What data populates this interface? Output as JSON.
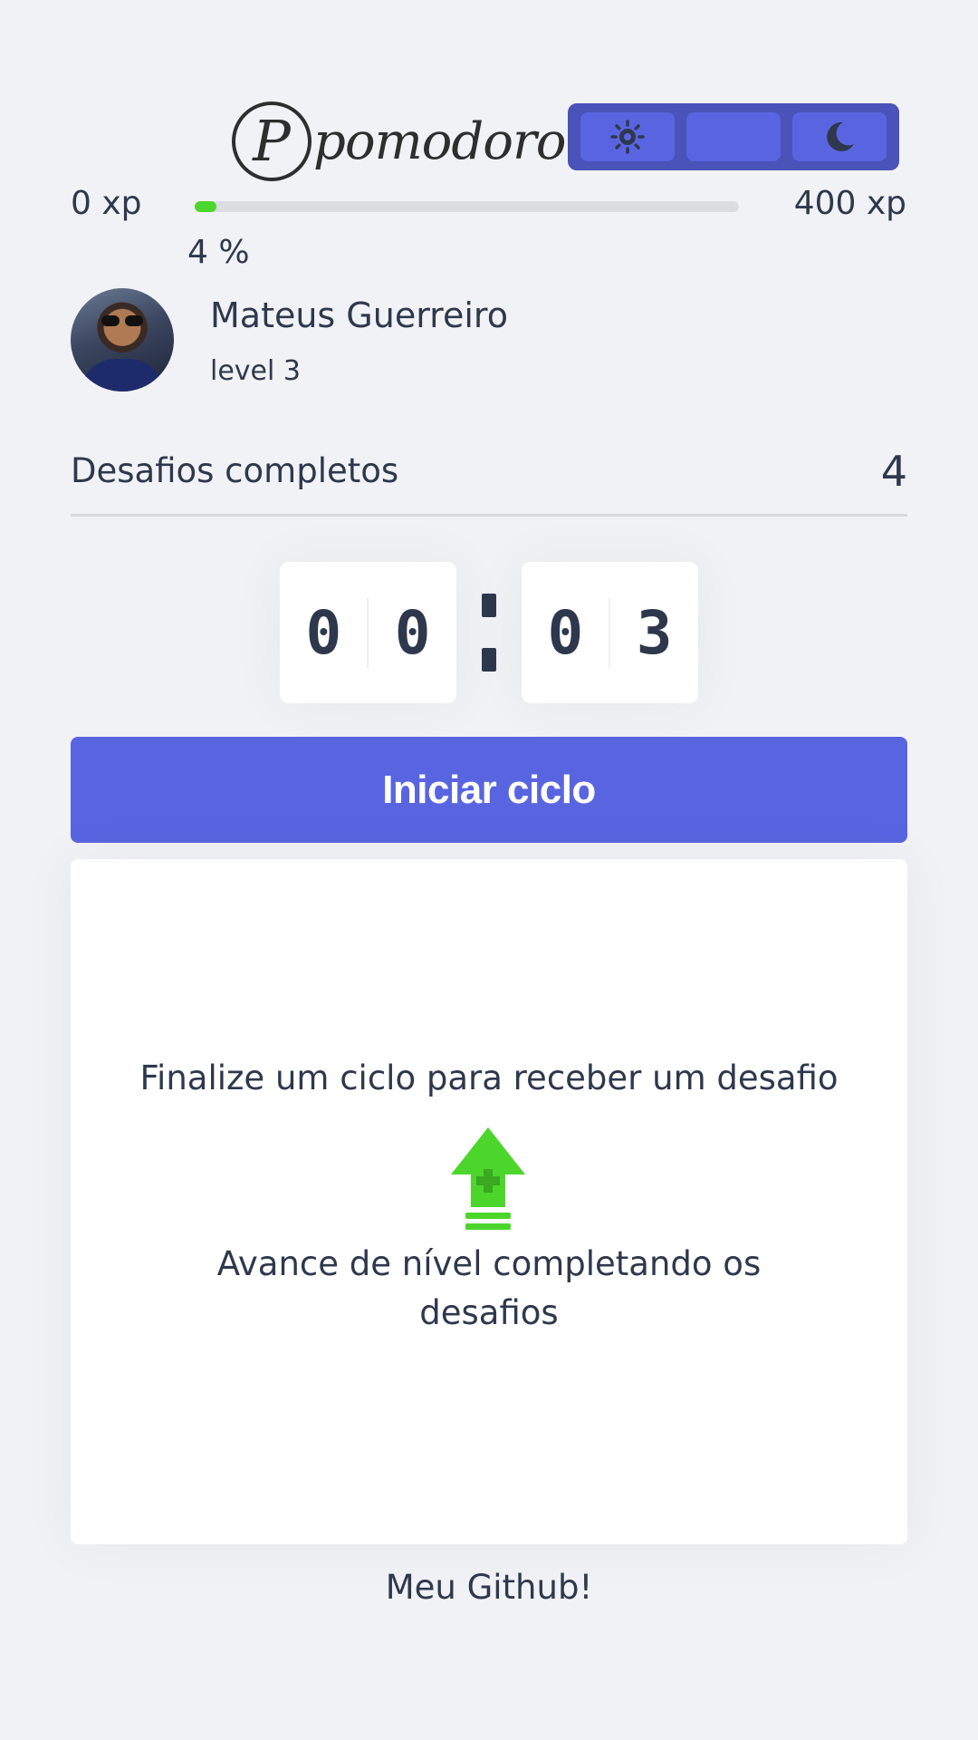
{
  "header": {
    "logo_letter": "P",
    "logo_text": "pomodoro",
    "theme_buttons": [
      {
        "icon": "sun-icon"
      },
      {
        "icon": ""
      },
      {
        "icon": "moon-icon"
      }
    ]
  },
  "xp": {
    "current_label": "0 xp",
    "max_label": "400 xp",
    "percent_label": "4 %",
    "progress_percent": 4,
    "bar_color": "#4cd62b"
  },
  "profile": {
    "name": "Mateus Guerreiro",
    "level": "level 3"
  },
  "completed": {
    "label": "Desafios completos",
    "count": "4"
  },
  "countdown": {
    "minute_left": "0",
    "minute_right": "0",
    "second_left": "0",
    "second_right": "3"
  },
  "start_button": {
    "label": "Iniciar ciclo",
    "color": "#5965e0"
  },
  "challenge": {
    "title": "Finalize um ciclo para receber um desafio",
    "icon": "level-up-icon",
    "subtitle": "Avance de nível completando os desafios"
  },
  "footer": {
    "github_label": "Meu Github!"
  },
  "colors": {
    "background": "#f1f2f5",
    "text": "#2e384d",
    "accent": "#5965e0",
    "toggle_bg": "#4953b8",
    "success": "#4cd62b"
  }
}
